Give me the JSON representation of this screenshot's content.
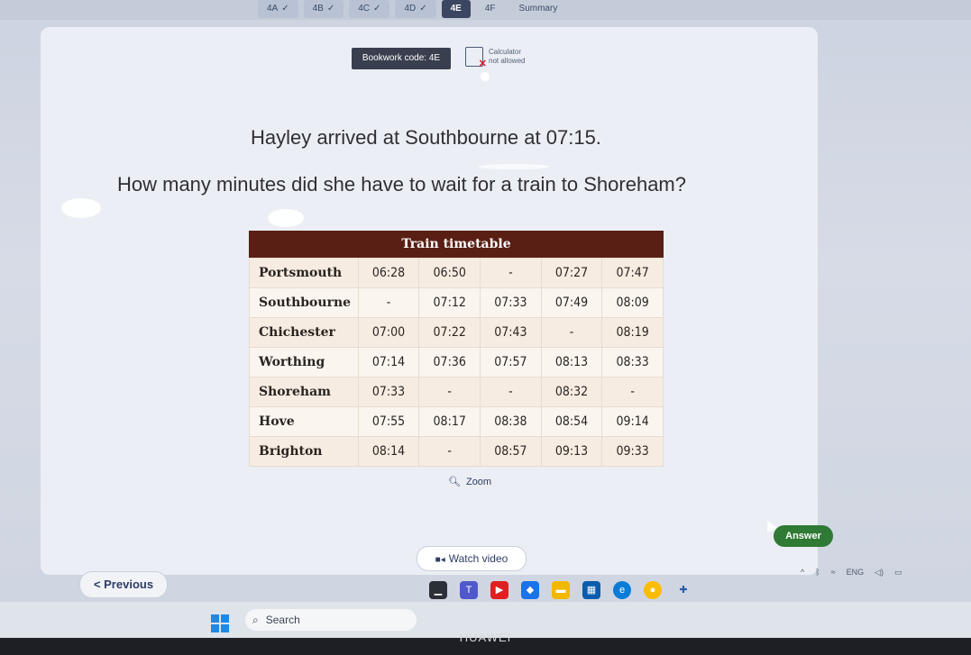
{
  "tabs": [
    {
      "label": "4A",
      "done": true
    },
    {
      "label": "4B",
      "done": true
    },
    {
      "label": "4C",
      "done": true
    },
    {
      "label": "4D",
      "done": true
    },
    {
      "label": "4E",
      "done": false,
      "active": true
    },
    {
      "label": "4F",
      "done": false
    },
    {
      "label": "Summary",
      "done": false
    }
  ],
  "check_glyph": "✓",
  "bookwork_code": "Bookwork code: 4E",
  "calculator": {
    "line1": "Calculator",
    "line2": "not allowed",
    "icon": "calculator-crossed-icon"
  },
  "question": {
    "line1": "Hayley arrived at Southbourne at 07:15.",
    "line2": "How many minutes did she have to wait for a train to Shoreham?"
  },
  "timetable": {
    "title": "Train timetable",
    "rows": [
      {
        "station": "Portsmouth",
        "times": [
          "06:28",
          "06:50",
          "-",
          "07:27",
          "07:47"
        ]
      },
      {
        "station": "Southbourne",
        "times": [
          "-",
          "07:12",
          "07:33",
          "07:49",
          "08:09"
        ]
      },
      {
        "station": "Chichester",
        "times": [
          "07:00",
          "07:22",
          "07:43",
          "-",
          "08:19"
        ]
      },
      {
        "station": "Worthing",
        "times": [
          "07:14",
          "07:36",
          "07:57",
          "08:13",
          "08:33"
        ]
      },
      {
        "station": "Shoreham",
        "times": [
          "07:33",
          "-",
          "-",
          "08:32",
          "-"
        ]
      },
      {
        "station": "Hove",
        "times": [
          "07:55",
          "08:17",
          "08:38",
          "08:54",
          "09:14"
        ]
      },
      {
        "station": "Brighton",
        "times": [
          "08:14",
          "-",
          "08:57",
          "09:13",
          "09:33"
        ]
      }
    ]
  },
  "zoom_label": "Zoom",
  "answer_button": "Answer",
  "watch_video_button": "Watch video",
  "previous_button": "< Previous",
  "taskbar": {
    "search_placeholder": "Search",
    "language": "ENG"
  },
  "brand": "HUAWEI",
  "colors": {
    "accent_green": "#2f7a34",
    "timetable_header": "#5a1f14",
    "bookwork_bg": "#3a3f4f",
    "active_tab": "#3b4660"
  }
}
